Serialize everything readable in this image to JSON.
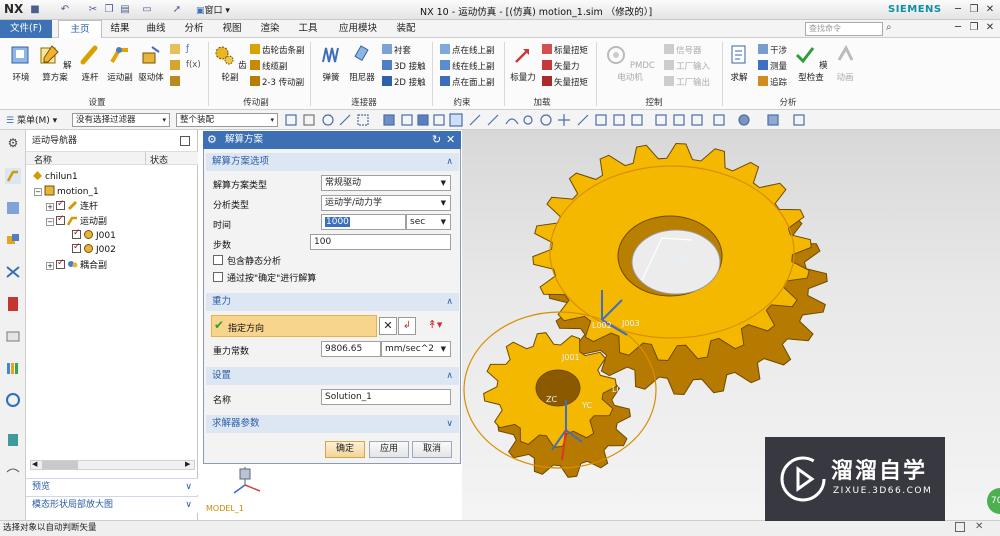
{
  "window": {
    "app_logo": "NX",
    "title": "NX 10 - 运动仿真 - [(仿真) motion_1.sim  （修改的）]",
    "brand": "SIEMENS",
    "search_placeholder": "查找命令",
    "quick_window_label": "窗口"
  },
  "menu": {
    "file": "文件(F)",
    "tabs": [
      "主页",
      "结果",
      "曲线",
      "分析",
      "视图",
      "渲染",
      "工具",
      "应用模块",
      "装配"
    ],
    "active_tab": "主页"
  },
  "ribbon": {
    "settings": {
      "label": "设置",
      "buttons": [
        "环境",
        "解算方案",
        "连杆",
        "运动副",
        "驱动体"
      ]
    },
    "transmission": {
      "label": "传动副",
      "big": "齿轮副",
      "small": [
        "齿轮齿条副",
        "线缆副",
        "2-3 传动副"
      ]
    },
    "connector": {
      "label": "连接器",
      "buttons": [
        "弹簧",
        "阻尼器"
      ],
      "small": [
        "衬套",
        "3D 接触",
        "2D 接触"
      ]
    },
    "constraint": {
      "label": "约束",
      "small": [
        "点在线上副",
        "线在线上副",
        "点在面上副"
      ]
    },
    "load": {
      "label": "加载",
      "big": "标量力",
      "small": [
        "标量扭矩",
        "矢量力",
        "矢量扭矩"
      ]
    },
    "control": {
      "label": "控制",
      "big": "PMDC 电动机",
      "small": [
        "信号器",
        "工厂输入",
        "工厂输出"
      ]
    },
    "analysis": {
      "label": "分析",
      "buttons": [
        "求解",
        "模型检查",
        "动画"
      ],
      "small": [
        "干涉",
        "测量",
        "追踪"
      ]
    }
  },
  "toolbar": {
    "menu": "菜单(M)",
    "filter": "没有选择过滤器",
    "assembly": "整个装配"
  },
  "navigator": {
    "title": "运动导航器",
    "columns": [
      "名称",
      "状态"
    ],
    "tree": [
      {
        "label": "chilun1",
        "level": 0
      },
      {
        "label": "motion_1",
        "level": 1
      },
      {
        "label": "连杆",
        "level": 2
      },
      {
        "label": "运动副",
        "level": 2
      },
      {
        "label": "J001",
        "level": 3
      },
      {
        "label": "J002",
        "level": 3
      },
      {
        "label": "耦合副",
        "level": 2
      }
    ],
    "bottom_panels": [
      "预览",
      "模态形状局部放大图"
    ]
  },
  "dialog": {
    "title": "解算方案",
    "section_options": "解算方案选项",
    "solution_type_label": "解算方案类型",
    "solution_type": "常规驱动",
    "analysis_type_label": "分析类型",
    "analysis_type": "运动学/动力学",
    "time_label": "时间",
    "time_value": "1000",
    "time_unit": "sec",
    "steps_label": "步数",
    "steps_value": "100",
    "static_check": "包含静态分析",
    "ok_solve_check": "通过按\"确定\"进行解算",
    "section_gravity": "重力",
    "direction_label": "指定方向",
    "gravity_const_label": "重力常数",
    "gravity_const": "9806.65",
    "gravity_unit": "mm/sec^2",
    "section_settings": "设置",
    "name_label": "名称",
    "name_value": "Solution_1",
    "section_solver": "求解器参数",
    "buttons": {
      "ok": "确定",
      "apply": "应用",
      "cancel": "取消"
    }
  },
  "viewport": {
    "labels": [
      "J002",
      "J003",
      "J001",
      "L002",
      "L001",
      "YC",
      "ZC",
      "MODEL_1"
    ],
    "colors": {
      "gear": "#f5b800",
      "gear_side": "#b77a00",
      "gear_edge": "#6e4a00"
    }
  },
  "status": {
    "text": "选择对象以自动判断矢量"
  },
  "watermark": {
    "title": "溜溜自学",
    "url": "ZIXUE.3D66.COM",
    "badge": "70"
  }
}
